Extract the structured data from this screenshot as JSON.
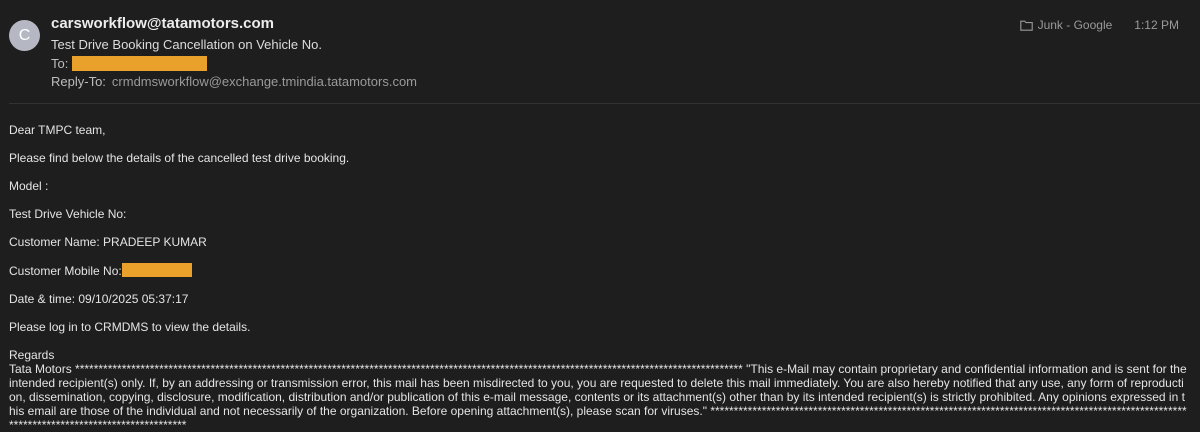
{
  "email": {
    "avatar_letter": "C",
    "sender": "carsworkflow@tatamotors.com",
    "subject": "Test Drive Booking Cancellation on Vehicle No.",
    "to_label": "To:",
    "reply_to_label": "Reply-To:",
    "reply_to": "crmdmsworkflow@exchange.tmindia.tatamotors.com",
    "folder": "Junk - Google",
    "folder_icon": "folder-icon",
    "time": "1:12 PM",
    "redaction_color": "#e9a12c"
  },
  "body": {
    "greeting": "Dear TMPC team,",
    "intro": "Please find below the details of the cancelled test drive booking.",
    "model": "Model :",
    "vehicle_no": "Test Drive Vehicle No:",
    "customer_name": "Customer Name: PRADEEP KUMAR",
    "customer_mobile_label": "Customer Mobile No:",
    "date_time": "Date & time: 09/10/2025 05:37:17",
    "login_note": "Please log in to CRMDMS to view the details.",
    "regards": "Regards",
    "disclaimer": "Tata Motors *********************************************************************************************************************************************** \"This e-Mail may contain proprietary and confidential information and is sent for the intended recipient(s) only. If, by an addressing or transmission error, this mail has been misdirected to you, you are requested to delete this mail immediately. You are also hereby notified that any use, any form of reproduction, dissemination, copying, disclosure, modification, distribution and/or publication of this e-mail message, contents or its attachment(s) other than by its intended recipient(s) is strictly prohibited. Any opinions expressed in this email are those of the individual and not necessarily of the organization. Before opening attachment(s), please scan for viruses.\" ********************************************************************************************************************************************"
  }
}
